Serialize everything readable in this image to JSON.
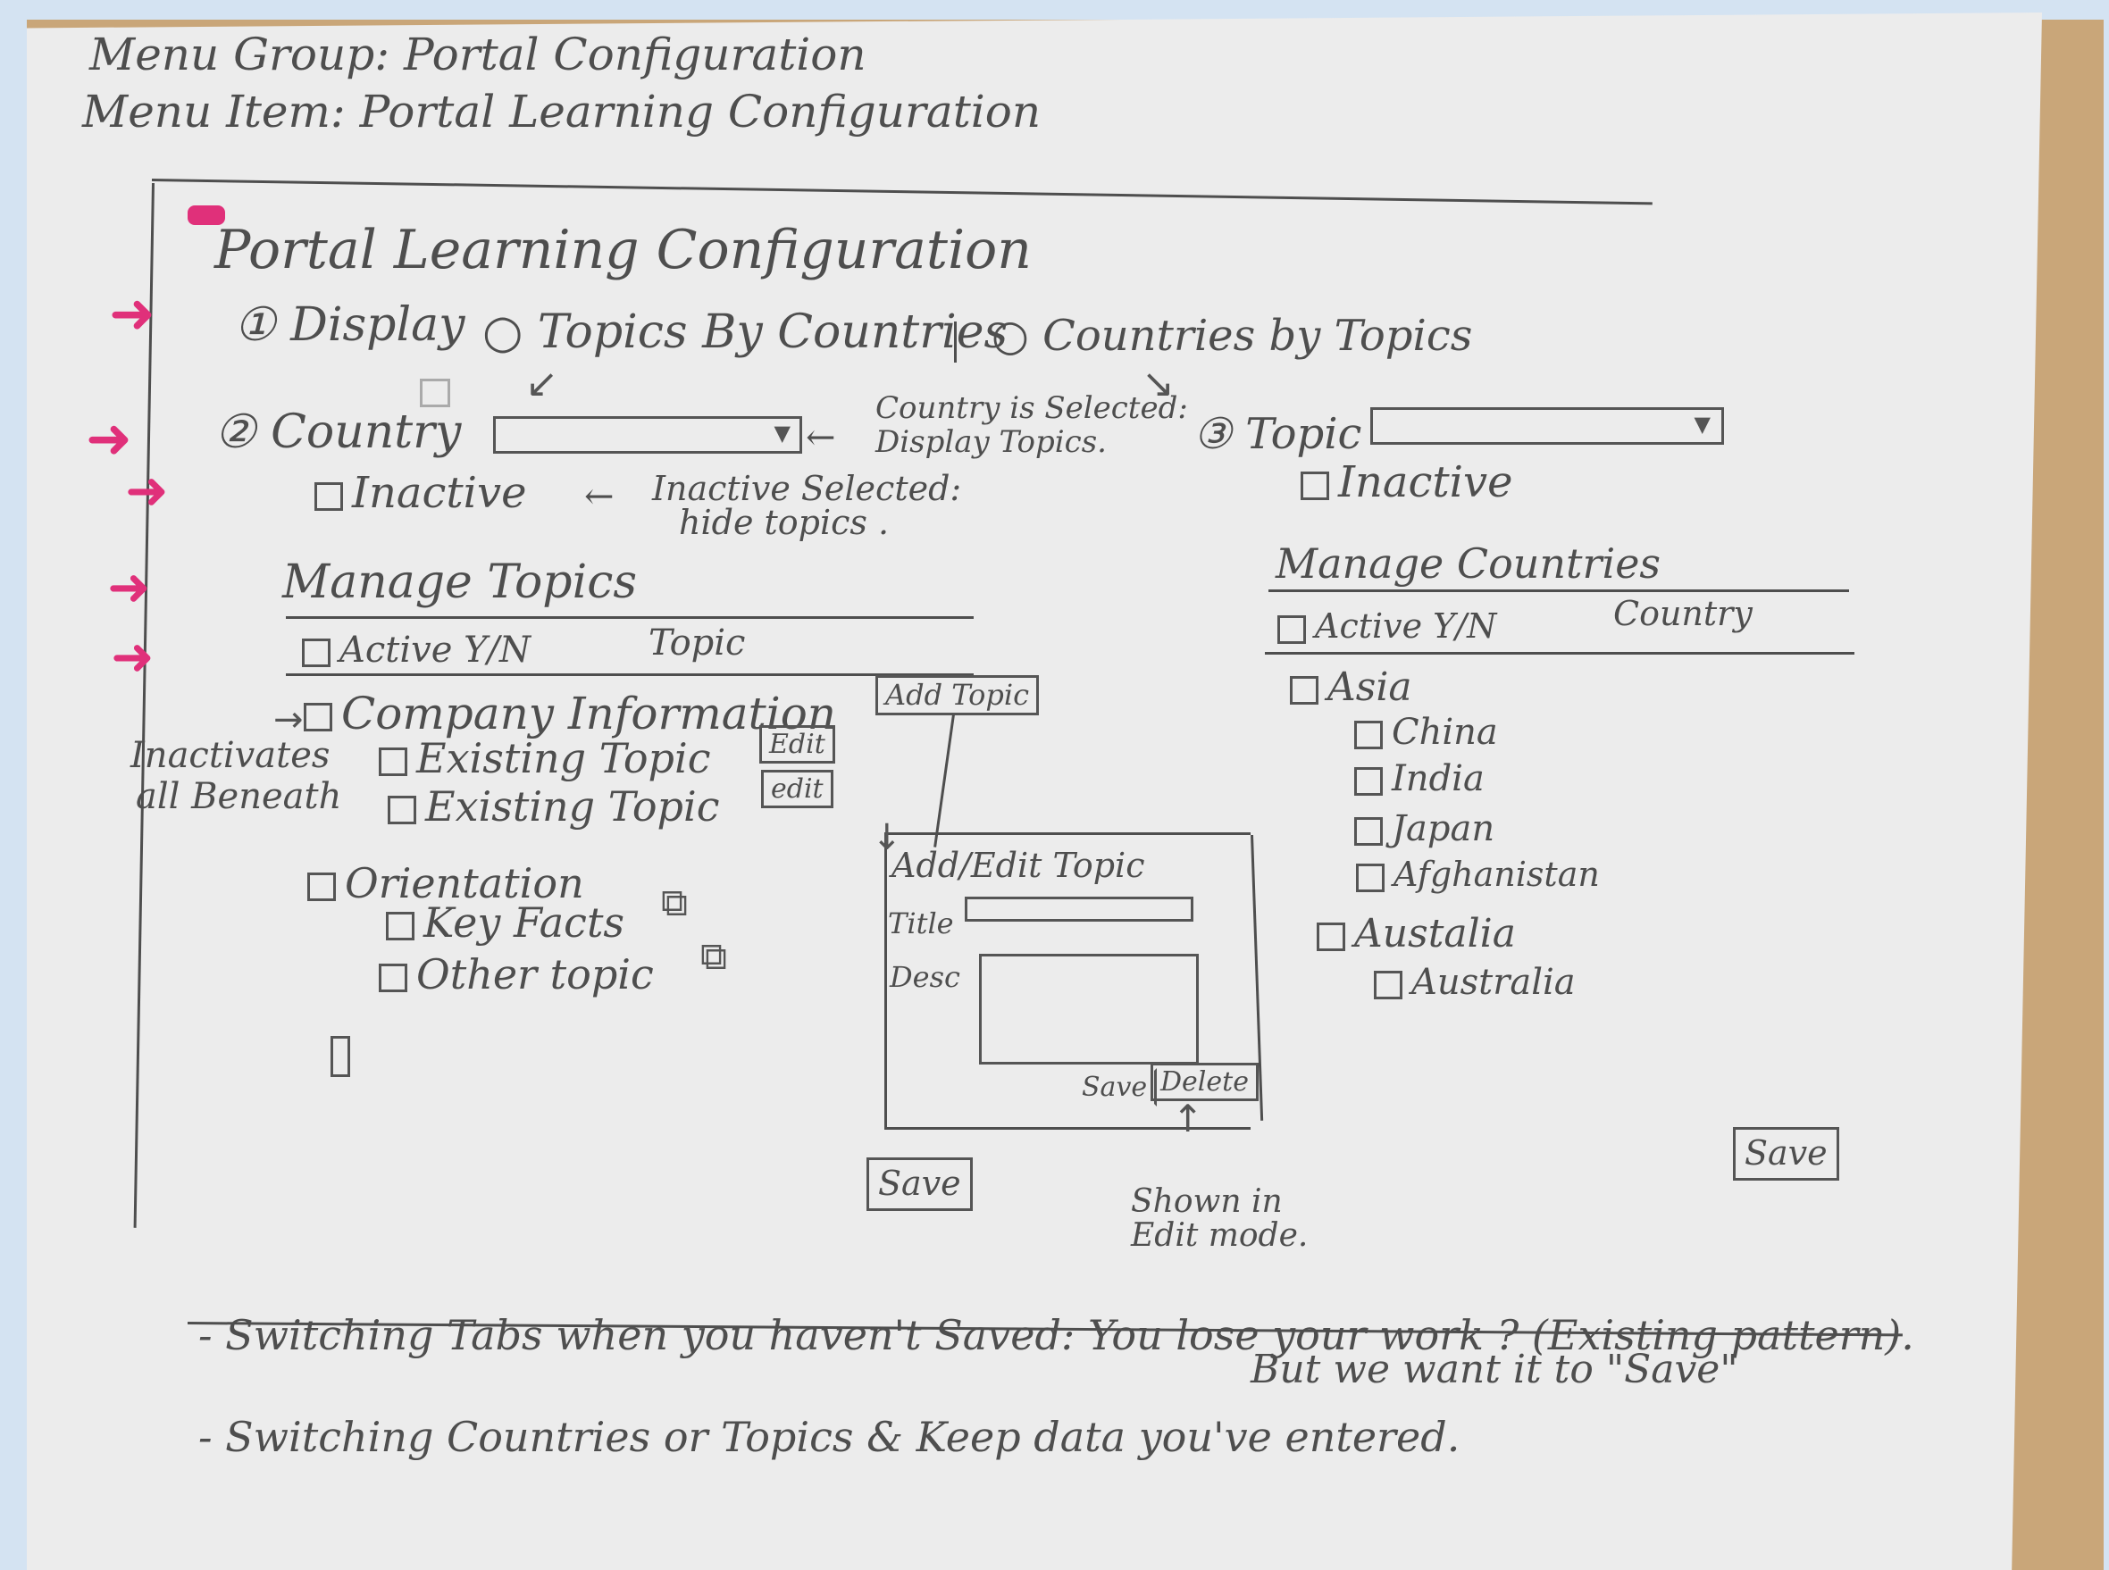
{
  "menu": {
    "group": "Menu Group: Portal Configuration",
    "item": "Menu Item: Portal Learning Configuration"
  },
  "page_title": "Portal Learning Configuration",
  "display": {
    "label": "① Display",
    "option_topics_by_countries": "Topics By Countries",
    "option_countries_by_topics": "Countries by Topics"
  },
  "country": {
    "label": "② Country",
    "note_line1": "Country is Selected:",
    "note_line2": "Display Topics.",
    "inactive_label": "Inactive",
    "inactive_note_line1": "Inactive Selected:",
    "inactive_note_line2": "hide topics ."
  },
  "topic": {
    "label": "③ Topic",
    "inactive_label": "Inactive"
  },
  "manage_topics": {
    "title": "Manage Topics",
    "col_active": "Active Y/N",
    "col_topic": "Topic",
    "add_topic_label": "Add Topic",
    "inactivates_note_line1": "Inactivates",
    "inactivates_note_line2": "all Beneath",
    "groups": [
      {
        "name": "Company Information",
        "children": [
          {
            "name": "Existing Topic",
            "action": "Edit"
          },
          {
            "name": "Existing Topic",
            "action": "edit"
          }
        ]
      },
      {
        "name": "Orientation",
        "children": [
          {
            "name": "Key Facts"
          },
          {
            "name": "Other topic"
          }
        ]
      }
    ],
    "save_label": "Save"
  },
  "add_edit": {
    "title": "Add/Edit Topic",
    "title_label": "Title",
    "desc_label": "Desc",
    "save_label": "Save",
    "delete_label": "Delete",
    "note_line1": "Shown in",
    "note_line2": "Edit mode."
  },
  "manage_countries": {
    "title": "Manage Countries",
    "col_active": "Active Y/N",
    "col_country": "Country",
    "regions": [
      {
        "name": "Asia",
        "countries": [
          "China",
          "India",
          "Japan",
          "Afghanistan"
        ]
      },
      {
        "name": "Austalia",
        "countries": [
          "Australia"
        ]
      }
    ],
    "save_label": "Save"
  },
  "notes": {
    "line1": "- Switching Tabs when you haven't Saved: You lose your work ? (Existing pattern).",
    "line1b": "But we want it to \"Save\"",
    "line2": "- Switching Countries or Topics & Keep data you've entered."
  },
  "colors": {
    "ink": "#4e4e4e",
    "highlighter": "#e0307a",
    "paper": "#ececec",
    "desk": "#c9a679"
  }
}
